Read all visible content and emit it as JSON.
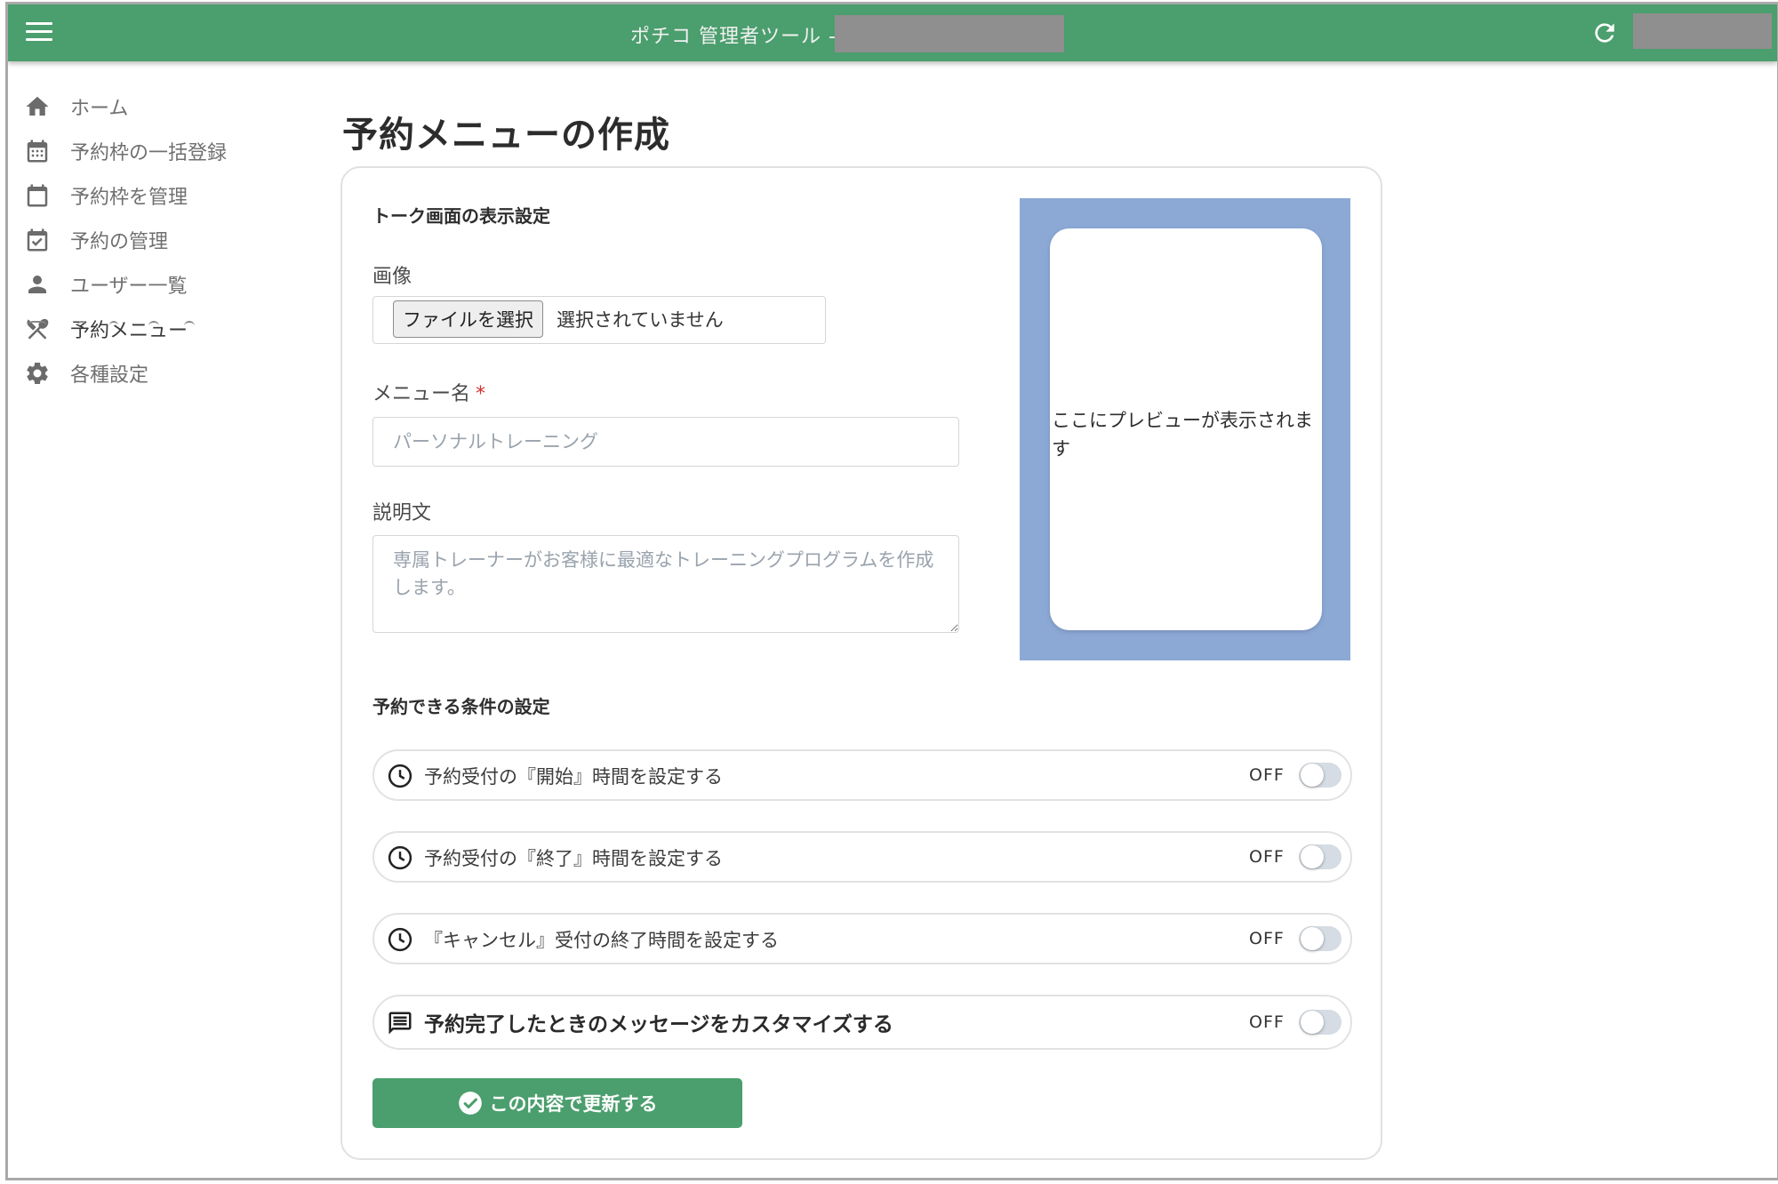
{
  "header": {
    "app_title": "ポチコ 管理者ツール -",
    "menu_icon": "hamburger-menu-icon",
    "refresh_icon": "refresh-icon",
    "brand_color": "#4b9e6d"
  },
  "sidebar": {
    "items": [
      {
        "label": "ホーム",
        "icon": "home-icon"
      },
      {
        "label": "予約枠の一括登録",
        "icon": "calendar-grid-icon"
      },
      {
        "label": "予約枠を管理",
        "icon": "calendar-icon"
      },
      {
        "label": "予約の管理",
        "icon": "calendar-check-icon"
      },
      {
        "label": "ユーザー一覧",
        "icon": "person-icon"
      },
      {
        "label": "予約メニュー",
        "icon": "utensils-icon"
      },
      {
        "label": "各種設定",
        "icon": "gear-icon"
      }
    ]
  },
  "main": {
    "page_title": "予約メニューの作成",
    "talk_section_title": "トーク画面の表示設定",
    "image_label": "画像",
    "file_button_label": "ファイルを選択",
    "file_status": "選択されていません",
    "menu_name_label": "メニュー名",
    "required_mark": "*",
    "menu_name_placeholder": "パーソナルトレーニング",
    "description_label": "説明文",
    "description_placeholder": "専属トレーナーがお客様に最適なトレーニングプログラムを作成します。",
    "preview_text": "ここにプレビューが表示されます",
    "conditions_section_title": "予約できる条件の設定",
    "toggles": [
      {
        "label": "予約受付の『開始』時間を設定する",
        "state": "OFF",
        "icon": "clock-icon"
      },
      {
        "label": "予約受付の『終了』時間を設定する",
        "state": "OFF",
        "icon": "clock-icon"
      },
      {
        "label": "『キャンセル』受付の終了時間を設定する",
        "state": "OFF",
        "icon": "clock-icon"
      },
      {
        "label": "予約完了したときのメッセージをカスタマイズする",
        "state": "OFF",
        "icon": "message-icon"
      }
    ],
    "submit_label": "この内容で更新する"
  }
}
